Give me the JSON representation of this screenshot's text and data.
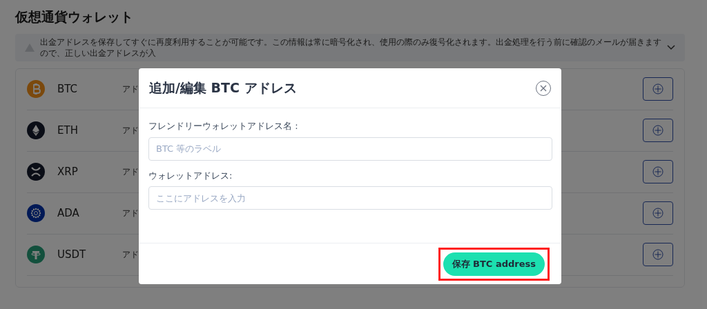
{
  "page": {
    "title": "仮想通貨ウォレット"
  },
  "notice": {
    "text": "出金アドレスを保存してすぐに再度利用することが可能です。この情報は常に暗号化され、使用の際のみ復号化されます。出金処理を行う前に確認のメールが届きますので、正しい出金アドレスが入"
  },
  "wallets": [
    {
      "kind": "btc",
      "symbol": "BTC",
      "address": "アド"
    },
    {
      "kind": "eth",
      "symbol": "ETH",
      "address": "アド"
    },
    {
      "kind": "xrp",
      "symbol": "XRP",
      "address": "アド"
    },
    {
      "kind": "ada",
      "symbol": "ADA",
      "address": "アド"
    },
    {
      "kind": "usdt",
      "symbol": "USDT",
      "address": "アド"
    }
  ],
  "dialog": {
    "title": "追加/編集 BTC アドレス",
    "fields": [
      {
        "label": "フレンドリーウォレットアドレス名 :",
        "placeholder": "BTC 等のラベル"
      },
      {
        "label": "ウォレットアドレス:",
        "placeholder": "ここにアドレスを入力"
      }
    ],
    "save_button": {
      "label": "保存 BTC address",
      "highlighted": true
    }
  }
}
